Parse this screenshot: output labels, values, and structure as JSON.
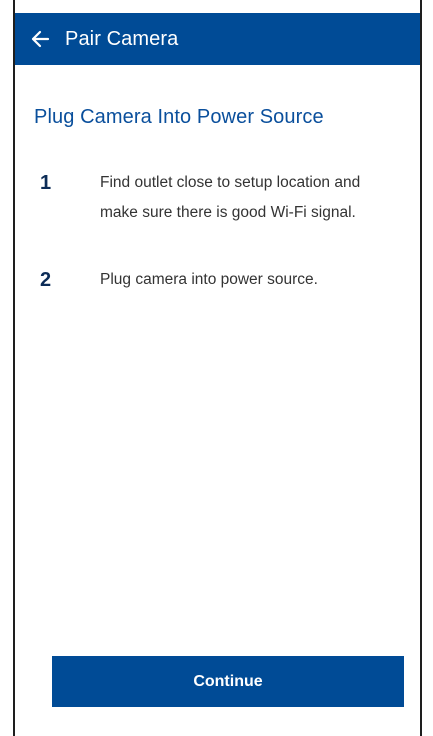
{
  "header": {
    "back_icon": "arrow-left-icon",
    "title": "Pair Camera"
  },
  "main": {
    "heading": "Plug Camera Into Power Source",
    "steps": [
      {
        "number": "1",
        "text": "Find outlet close to setup location and make sure there is good Wi-Fi signal."
      },
      {
        "number": "2",
        "text": "Plug camera into power source."
      }
    ]
  },
  "footer": {
    "continue_label": "Continue"
  },
  "colors": {
    "primary": "#004b96",
    "heading": "#0a4f9c",
    "step_number": "#0c2c57",
    "body_text": "#333333",
    "background": "#ffffff"
  }
}
